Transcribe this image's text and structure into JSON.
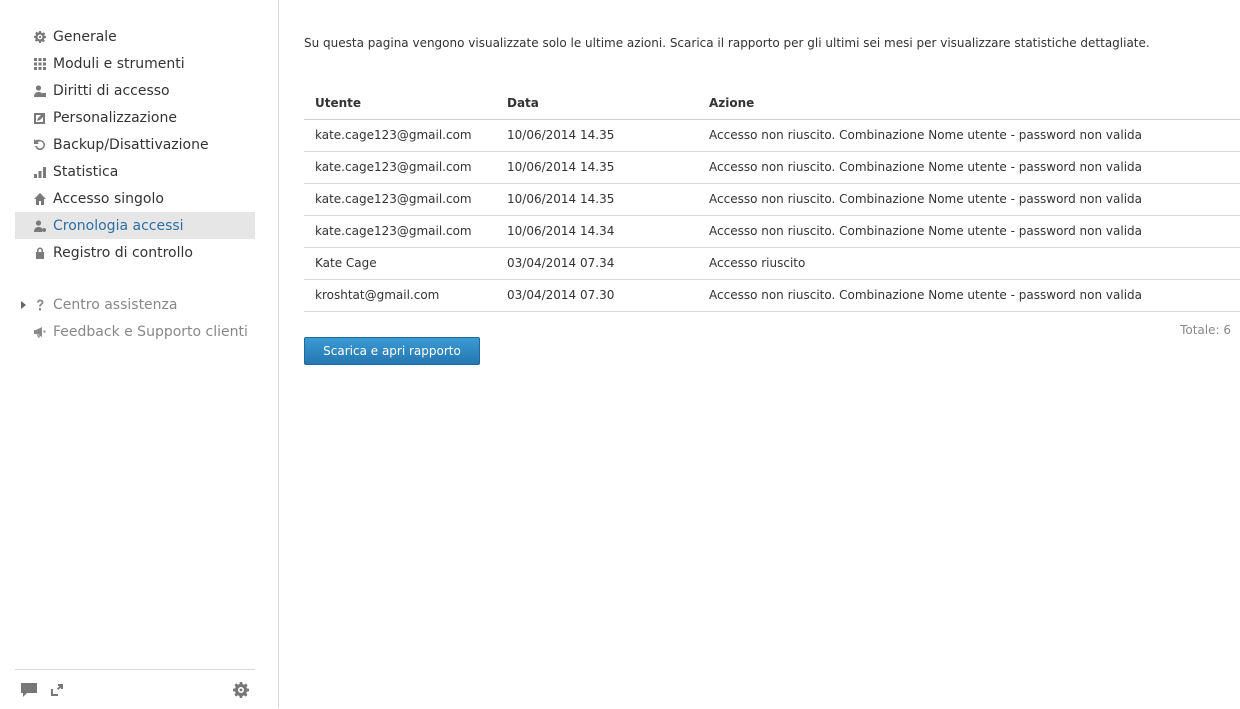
{
  "sidebar": {
    "items": [
      {
        "label": "Generale",
        "icon": "gear-icon"
      },
      {
        "label": "Moduli e strumenti",
        "icon": "grid-icon"
      },
      {
        "label": "Diritti di accesso",
        "icon": "user-lock-icon"
      },
      {
        "label": "Personalizzazione",
        "icon": "edit-square-icon"
      },
      {
        "label": "Backup/Disattivazione",
        "icon": "refresh-icon"
      },
      {
        "label": "Statistica",
        "icon": "bar-chart-icon"
      },
      {
        "label": "Accesso singolo",
        "icon": "home-icon"
      },
      {
        "label": "Cronologia accessi",
        "icon": "user-clock-icon",
        "active": true
      },
      {
        "label": "Registro di controllo",
        "icon": "lock-icon"
      }
    ],
    "secondary": [
      {
        "label": "Centro assistenza",
        "icon": "question-icon"
      },
      {
        "label": "Feedback e Supporto clienti",
        "icon": "megaphone-icon"
      }
    ]
  },
  "main": {
    "intro": "Su questa pagina vengono visualizzate solo le ultime azioni. Scarica il rapporto per gli ultimi sei mesi per visualizzare statistiche dettagliate.",
    "columns": [
      "Utente",
      "Data",
      "Azione"
    ],
    "rows": [
      [
        "kate.cage123@gmail.com",
        "10/06/2014 14.35",
        "Accesso non riuscito. Combinazione Nome utente - password non valida"
      ],
      [
        "kate.cage123@gmail.com",
        "10/06/2014 14.35",
        "Accesso non riuscito. Combinazione Nome utente - password non valida"
      ],
      [
        "kate.cage123@gmail.com",
        "10/06/2014 14.35",
        "Accesso non riuscito. Combinazione Nome utente - password non valida"
      ],
      [
        "kate.cage123@gmail.com",
        "10/06/2014 14.34",
        "Accesso non riuscito. Combinazione Nome utente - password non valida"
      ],
      [
        "Kate Cage",
        "03/04/2014 07.34",
        "Accesso riuscito"
      ],
      [
        "kroshtat@gmail.com",
        "03/04/2014 07.30",
        "Accesso non riuscito. Combinazione Nome utente - password non valida"
      ]
    ],
    "total": "Totale: 6",
    "download_button": "Scarica e apri rapporto"
  },
  "colors": {
    "accent": "#2c6fa8",
    "button": "#2a80bb",
    "active_bg": "#e6e6e6"
  }
}
